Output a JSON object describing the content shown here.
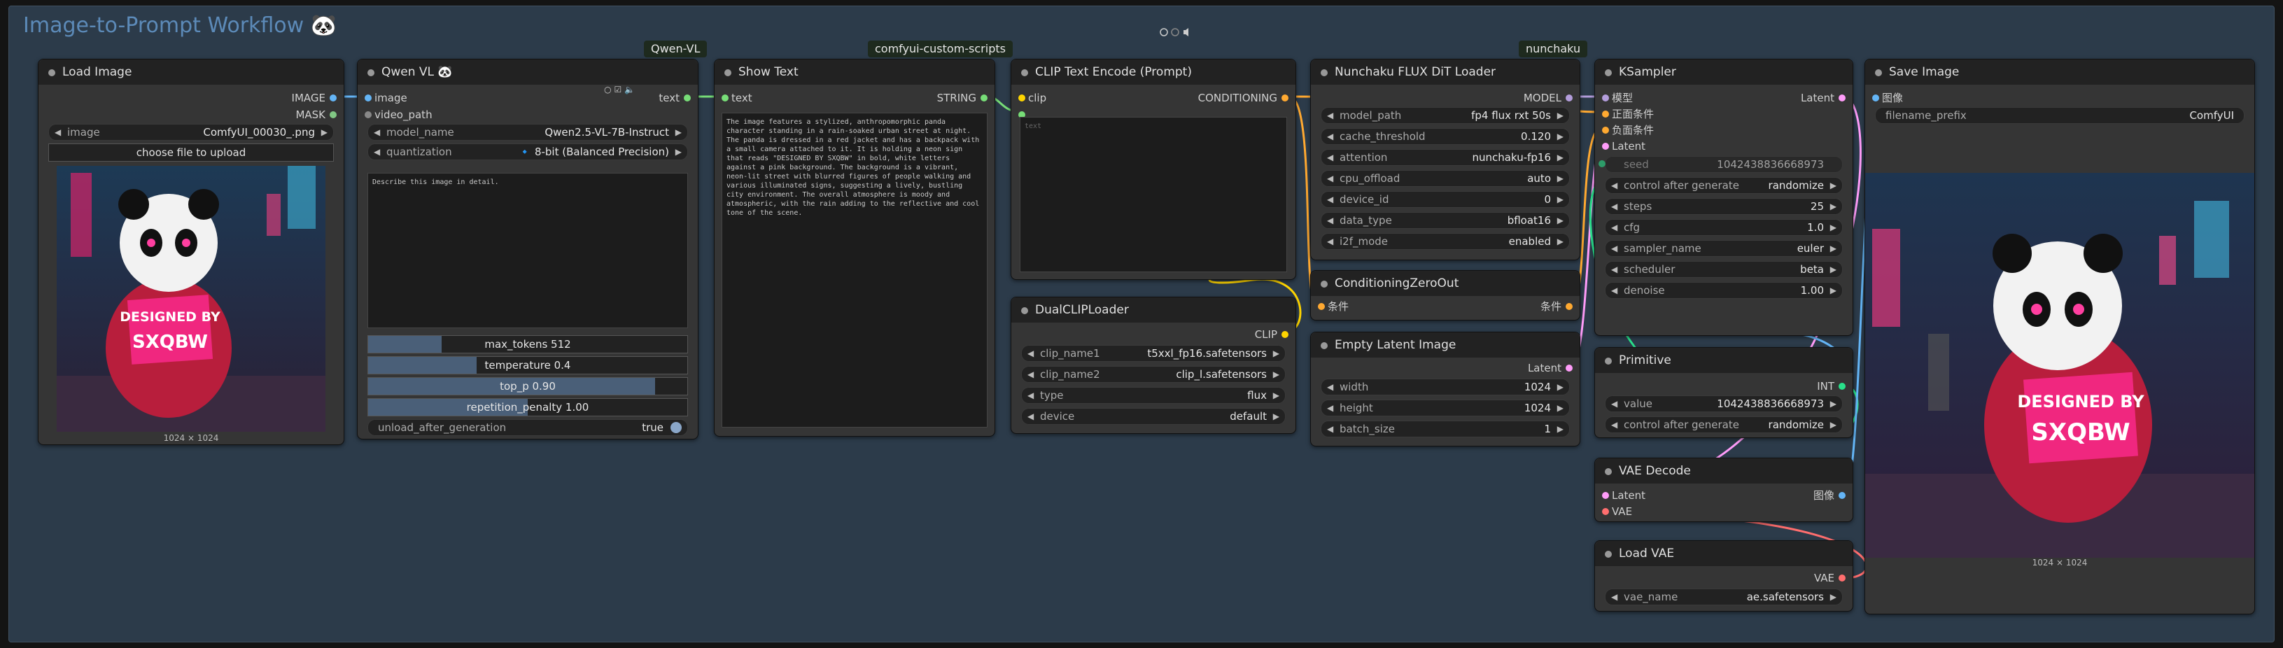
{
  "workflow": {
    "title": "Image-to-Prompt Workflow",
    "emoji": "🐼"
  },
  "top_controls": {
    "icons": [
      "circle-icon",
      "circle-icon",
      "speaker-icon"
    ]
  },
  "tags": {
    "qwen": "Qwen-VL",
    "scripts": "comfyui-custom-scripts",
    "nunchaku": "nunchaku"
  },
  "nodes": {
    "load_image": {
      "title": "Load Image",
      "outputs": [
        "IMAGE",
        "MASK"
      ],
      "image_label": "image",
      "image_value": "ComfyUI_00030_.png",
      "upload_button": "choose file to upload",
      "caption": "1024 × 1024"
    },
    "qwen_vl": {
      "title": "Qwen VL 🐼",
      "inputs": [
        "image",
        "video_path"
      ],
      "output": "text",
      "widgets": [
        {
          "k": "model_name",
          "v": "Qwen2.5-VL-7B-Instruct"
        },
        {
          "k": "quantization",
          "v": "🔹 8-bit (Balanced Precision)"
        }
      ],
      "prompt": "Describe this image in detail.",
      "sliders": [
        {
          "label": "max_tokens  512",
          "fill": 0.23
        },
        {
          "label": "temperature  0.4",
          "fill": 0.34
        },
        {
          "label": "top_p  0.90",
          "fill": 0.9
        },
        {
          "label": "repetition_penalty  1.00",
          "fill": 0.5
        }
      ],
      "toggle_label": "unload_after_generation",
      "toggle_value": "true"
    },
    "show_text": {
      "title": "Show Text",
      "input": "text",
      "output": "STRING",
      "text": "The image features a stylized, anthropomorphic panda character standing in a rain-soaked urban street at night. The panda is dressed in a red jacket and has a backpack with a small camera attached to it. It is holding a neon sign that reads \"DESIGNED BY SXQBW\" in bold, white letters against a pink background. The background is a vibrant, neon-lit street with blurred figures of people walking and various illuminated signs, suggesting a lively, bustling city environment. The overall atmosphere is moody and atmospheric, with the rain adding to the reflective and cool tone of the scene."
    },
    "clip_text_encode": {
      "title": "CLIP Text Encode (Prompt)",
      "inputs": [
        "clip",
        ""
      ],
      "output": "CONDITIONING",
      "text_label": "text"
    },
    "dual_clip": {
      "title": "DualCLIPLoader",
      "output": "CLIP",
      "widgets": [
        {
          "k": "clip_name1",
          "v": "t5xxl_fp16.safetensors"
        },
        {
          "k": "clip_name2",
          "v": "clip_l.safetensors"
        },
        {
          "k": "type",
          "v": "flux"
        },
        {
          "k": "device",
          "v": "default"
        }
      ]
    },
    "nunchaku": {
      "title": "Nunchaku FLUX DiT Loader",
      "output": "MODEL",
      "widgets": [
        {
          "k": "model_path",
          "v": "fp4 flux rxt 50s"
        },
        {
          "k": "cache_threshold",
          "v": "0.120"
        },
        {
          "k": "attention",
          "v": "nunchaku-fp16"
        },
        {
          "k": "cpu_offload",
          "v": "auto"
        },
        {
          "k": "device_id",
          "v": "0"
        },
        {
          "k": "data_type",
          "v": "bfloat16"
        },
        {
          "k": "i2f_mode",
          "v": "enabled"
        }
      ]
    },
    "cond_zero": {
      "title": "ConditioningZeroOut",
      "input": "条件",
      "output": "条件"
    },
    "empty_latent": {
      "title": "Empty Latent Image",
      "output": "Latent",
      "widgets": [
        {
          "k": "width",
          "v": "1024"
        },
        {
          "k": "height",
          "v": "1024"
        },
        {
          "k": "batch_size",
          "v": "1"
        }
      ]
    },
    "ksampler": {
      "title": "KSampler",
      "inputs": [
        "模型",
        "正面条件",
        "负面条件",
        "Latent"
      ],
      "output": "Latent",
      "seed_label": "seed",
      "seed_value": "1042438836668973",
      "widgets": [
        {
          "k": "control after generate",
          "v": "randomize"
        },
        {
          "k": "steps",
          "v": "25"
        },
        {
          "k": "cfg",
          "v": "1.0"
        },
        {
          "k": "sampler_name",
          "v": "euler"
        },
        {
          "k": "scheduler",
          "v": "beta"
        },
        {
          "k": "denoise",
          "v": "1.00"
        }
      ]
    },
    "primitive": {
      "title": "Primitive",
      "output": "INT",
      "widgets": [
        {
          "k": "value",
          "v": "1042438836668973"
        },
        {
          "k": "control after generate",
          "v": "randomize"
        }
      ]
    },
    "vae_decode": {
      "title": "VAE Decode",
      "inputs": [
        "Latent",
        "VAE"
      ],
      "output": "图像"
    },
    "load_vae": {
      "title": "Load VAE",
      "output": "VAE",
      "widgets": [
        {
          "k": "vae_name",
          "v": "ae.safetensors"
        }
      ]
    },
    "save_image": {
      "title": "Save Image",
      "input": "图像",
      "prefix_label": "filename_prefix",
      "prefix_value": "ComfyUI",
      "caption": "1024 × 1024"
    }
  },
  "sign_text": [
    "DESIGNED BY",
    "SXQBW"
  ],
  "colors": {
    "image": "#64b5f6",
    "string": "#77dd77",
    "clip": "#ffd500",
    "model": "#b39ddb",
    "latent": "#ff9cf9",
    "vae": "#ff6e6e",
    "cond": "#ffa931",
    "int": "#29e08a"
  }
}
